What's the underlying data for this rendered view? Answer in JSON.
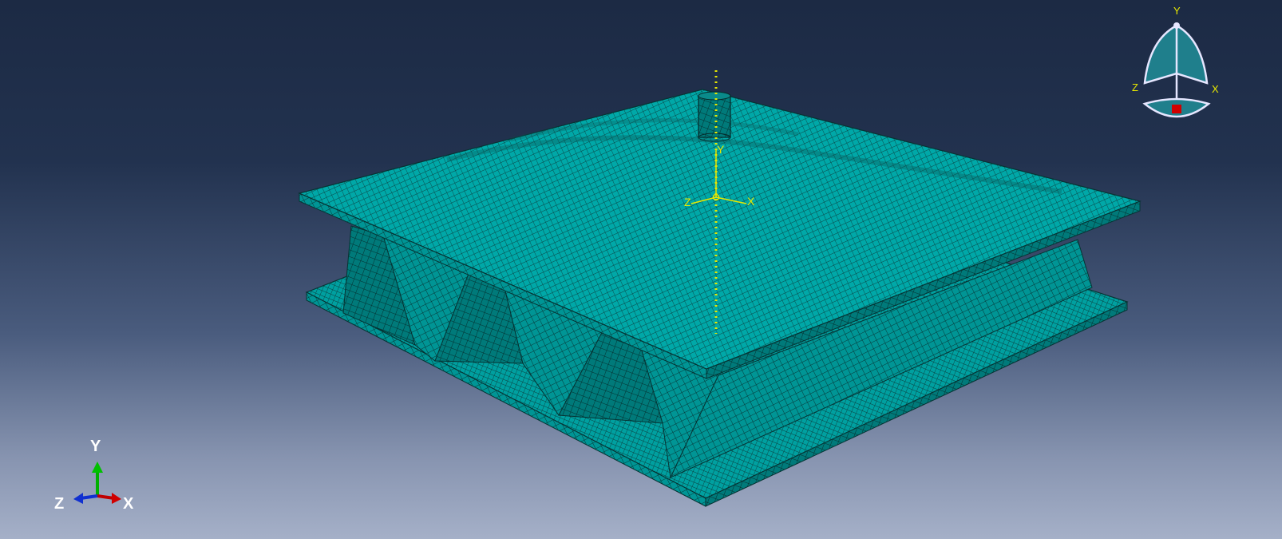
{
  "viewport": {
    "background_top": "#1c2a44",
    "background_bottom": "#a5b0c8",
    "mesh_color": "#00a8a8",
    "mesh_line_color": "#0a3a3a",
    "datum_color": "#e8e800"
  },
  "model": {
    "element_type": "meshed-part",
    "datum_csys": {
      "x_label": "X",
      "y_label": "Y",
      "z_label": "Z"
    }
  },
  "triad": {
    "x_label": "X",
    "y_label": "Y",
    "z_label": "Z",
    "x_color": "#c00000",
    "y_color": "#00b000",
    "z_color": "#1030d0"
  },
  "view_cube": {
    "x_label": "X",
    "y_label": "Y",
    "z_label": "Z",
    "home_marker_color": "#d00000"
  }
}
